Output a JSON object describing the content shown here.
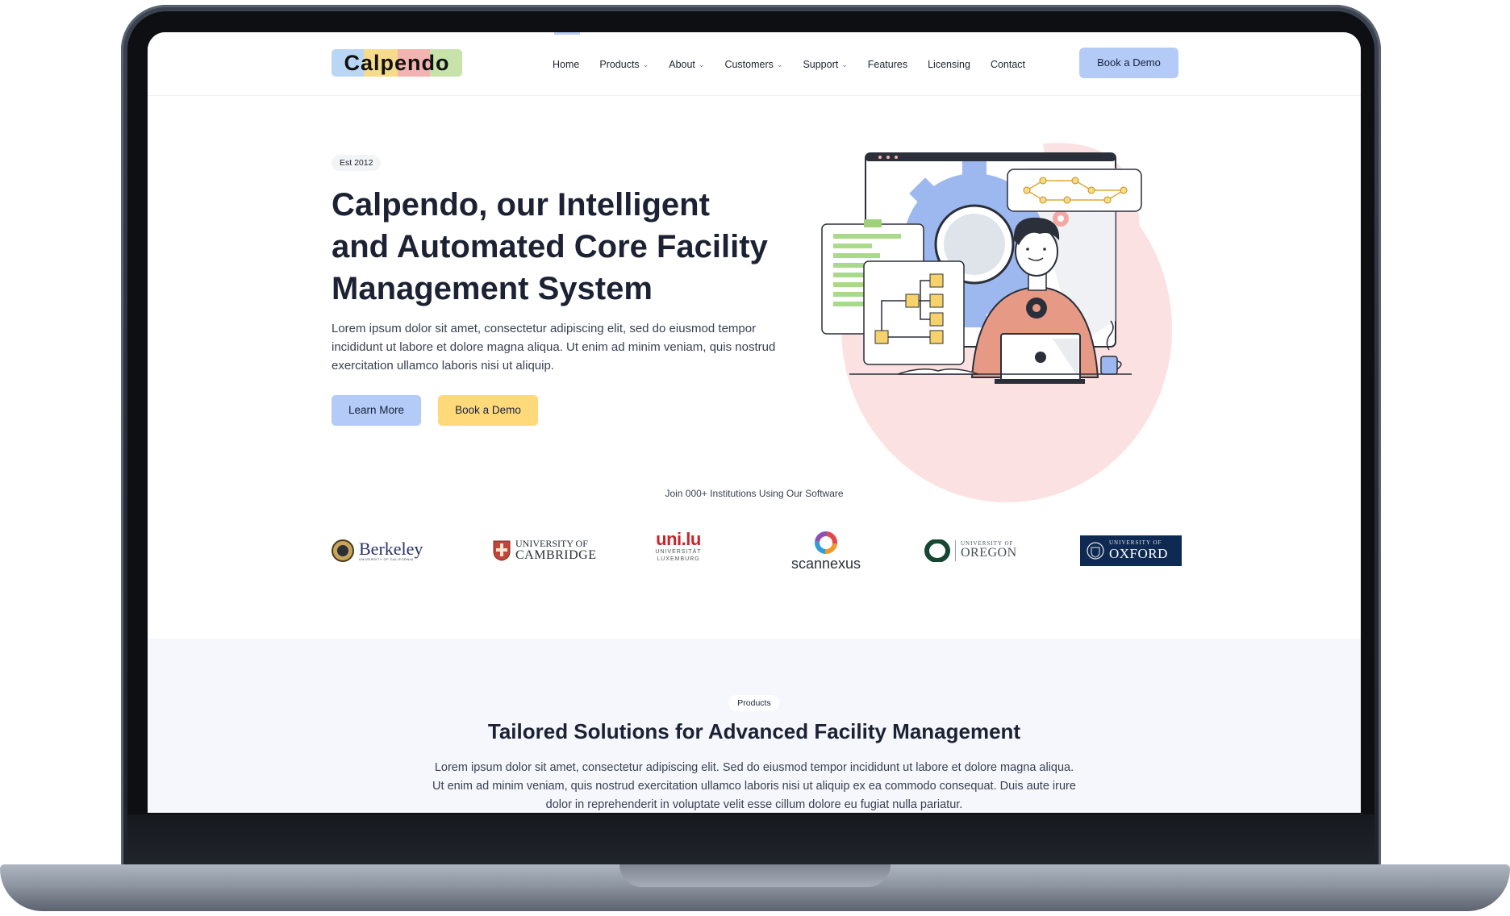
{
  "brand": {
    "name": "Calpendo",
    "logo_colors": [
      "#b9d7f5",
      "#f6dc8a",
      "#f3b3b0",
      "#c7e3a9"
    ]
  },
  "nav": {
    "items": [
      {
        "label": "Home",
        "has_dropdown": false
      },
      {
        "label": "Products",
        "has_dropdown": true
      },
      {
        "label": "About",
        "has_dropdown": true
      },
      {
        "label": "Customers",
        "has_dropdown": true
      },
      {
        "label": "Support",
        "has_dropdown": true
      },
      {
        "label": "Features",
        "has_dropdown": false
      },
      {
        "label": "Licensing",
        "has_dropdown": false
      },
      {
        "label": "Contact",
        "has_dropdown": false
      }
    ],
    "cta_label": "Book a Demo",
    "cta_color": "#b3cbf6"
  },
  "hero": {
    "badge": "Est 2012",
    "title_line1": "Calpendo, our Intelligent",
    "title_line2": "and Automated Core Facility",
    "title_line3": "Management System",
    "text": "Lorem ipsum dolor sit amet, consectetur adipiscing elit, sed do eiusmod tempor incididunt ut labore et dolore magna aliqua. Ut enim ad minim veniam, quis nostrud exercitation ullamco laboris nisi ut aliquip.",
    "learn_more": "Learn More",
    "book_demo": "Book a Demo",
    "accent_yellow": "#ffd97a"
  },
  "institutions": {
    "heading": "Join 000+ Institutions Using Our Software",
    "berkeley": "Berkeley",
    "berkeley_sub": "UNIVERSITY OF CALIFORNIA",
    "cambridge_1": "UNIVERSITY OF",
    "cambridge_2": "CAMBRIDGE",
    "unilu_1": "uni.lu",
    "unilu_2": "UNIVERSITÄT",
    "unilu_3": "LUXEMBURG",
    "scannexus": "scannexus",
    "oregon_1": "UNIVERSITY OF",
    "oregon_2": "OREGON",
    "oxford_1": "UNIVERSITY OF",
    "oxford_2": "OXFORD"
  },
  "products": {
    "pill": "Products",
    "title": "Tailored Solutions for Advanced Facility Management",
    "text": "Lorem ipsum dolor sit amet, consectetur adipiscing elit. Sed do eiusmod  tempor incididunt ut labore et dolore magna aliqua. Ut enim ad minim  veniam, quis nostrud exercitation ullamco laboris nisi ut aliquip ex ea  commodo consequat. Duis aute irure dolor in reprehenderit in voluptate velit esse cillum dolore eu fugiat nulla pariatur."
  }
}
